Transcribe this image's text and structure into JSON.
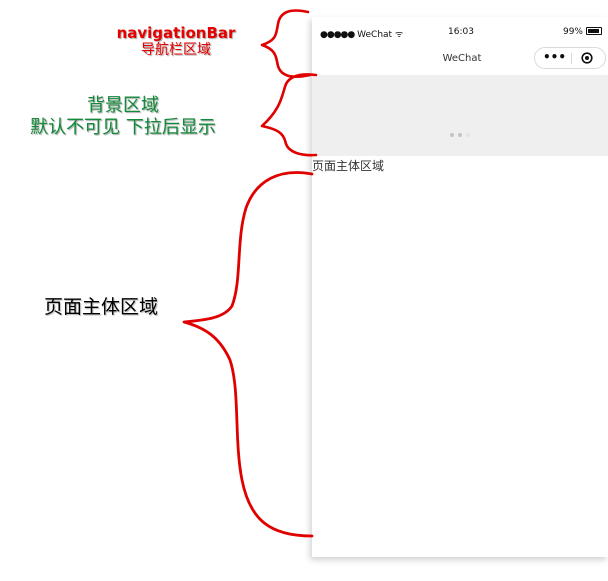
{
  "status_bar": {
    "signal": "●●●●●",
    "carrier": "WeChat",
    "wifi": "ᯤ",
    "time": "16:03",
    "battery": "99%"
  },
  "nav_bar": {
    "title": "WeChat",
    "more_icon": "•••",
    "close_icon": "target-circle-icon"
  },
  "background_area": {
    "fill_color": "#efefef",
    "pager_dots": [
      {
        "color": "#c4c4c4"
      },
      {
        "color": "#c4c4c4"
      },
      {
        "color": "#e4e4e4"
      }
    ]
  },
  "body_area": {
    "label": "页面主体区域"
  },
  "annotations": {
    "navigation_bar": {
      "title": "navigationBar",
      "subtitle": "导航栏区域",
      "color": "#e60000"
    },
    "background": {
      "title": "背景区域",
      "subtitle": "默认不可见 下拉后显示",
      "color": "#128a3a"
    },
    "page_body": {
      "title": "页面主体区域",
      "color": "#000000"
    },
    "brace_color": "#e00000"
  }
}
